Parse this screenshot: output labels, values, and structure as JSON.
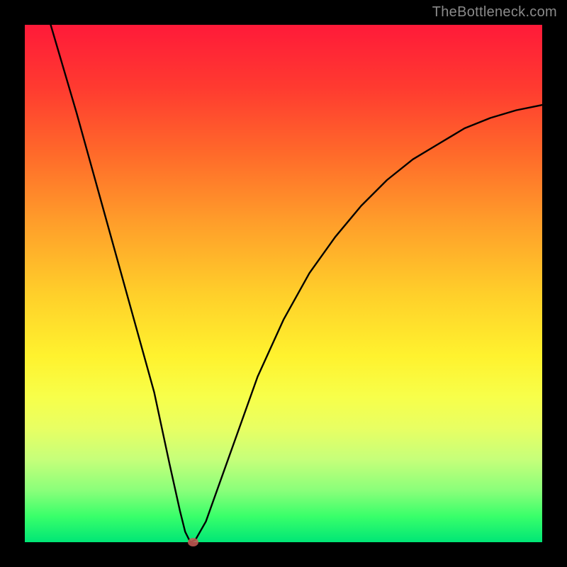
{
  "watermark": "TheBottleneck.com",
  "chart_data": {
    "type": "line",
    "title": "",
    "xlabel": "",
    "ylabel": "",
    "xlim": [
      0,
      100
    ],
    "ylim": [
      0,
      100
    ],
    "grid": false,
    "legend": false,
    "series": [
      {
        "name": "curve",
        "x": [
          5,
          10,
          15,
          20,
          25,
          28,
          30,
          31,
          32,
          33,
          35,
          40,
          45,
          50,
          55,
          60,
          65,
          70,
          75,
          80,
          85,
          90,
          95,
          100
        ],
        "y": [
          100,
          83,
          65,
          47,
          29,
          15,
          6,
          2,
          0,
          0.5,
          4,
          18,
          32,
          43,
          52,
          59,
          65,
          70,
          74,
          77,
          80,
          82,
          83.5,
          84.5
        ]
      }
    ],
    "marker": {
      "x": 32.5,
      "y": 0
    },
    "colors": {
      "curve": "#000000",
      "marker": "#c85a55",
      "gradient_top": "#ff1a39",
      "gradient_bottom": "#00e676",
      "frame": "#000000"
    }
  }
}
